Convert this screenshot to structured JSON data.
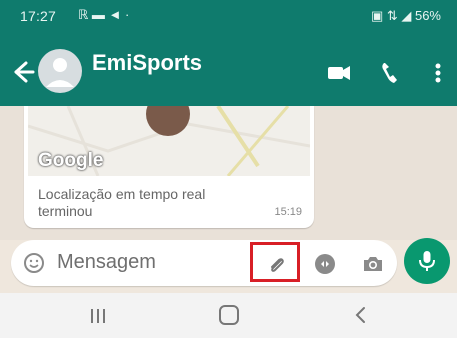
{
  "status_bar": {
    "time": "17:27",
    "left_icons": "ℝ ▬ ◄ ·",
    "right_icons": "▣ ⇅ ◢ 56%",
    "battery": "56%"
  },
  "app_bar": {
    "title": "EmiSports",
    "back_icon": "back-arrow-icon",
    "video_icon": "video-call-icon",
    "call_icon": "phone-call-icon",
    "more_icon": "more-vert-icon"
  },
  "message": {
    "map_brand": "Google",
    "caption": "Localização em tempo real terminou",
    "time": "15:19"
  },
  "composer": {
    "placeholder": "Mensagem",
    "emoji_icon": "emoji-icon",
    "attach_icon": "paperclip-icon",
    "payment_icon": "payment-icon",
    "camera_icon": "camera-icon",
    "mic_icon": "microphone-icon"
  },
  "nav": {
    "recent_icon": "recent-apps-icon",
    "home_icon": "home-icon",
    "back_icon": "back-icon"
  },
  "colors": {
    "primary": "#0f7b6d",
    "accent": "#09986f",
    "highlight": "#d81f26"
  }
}
